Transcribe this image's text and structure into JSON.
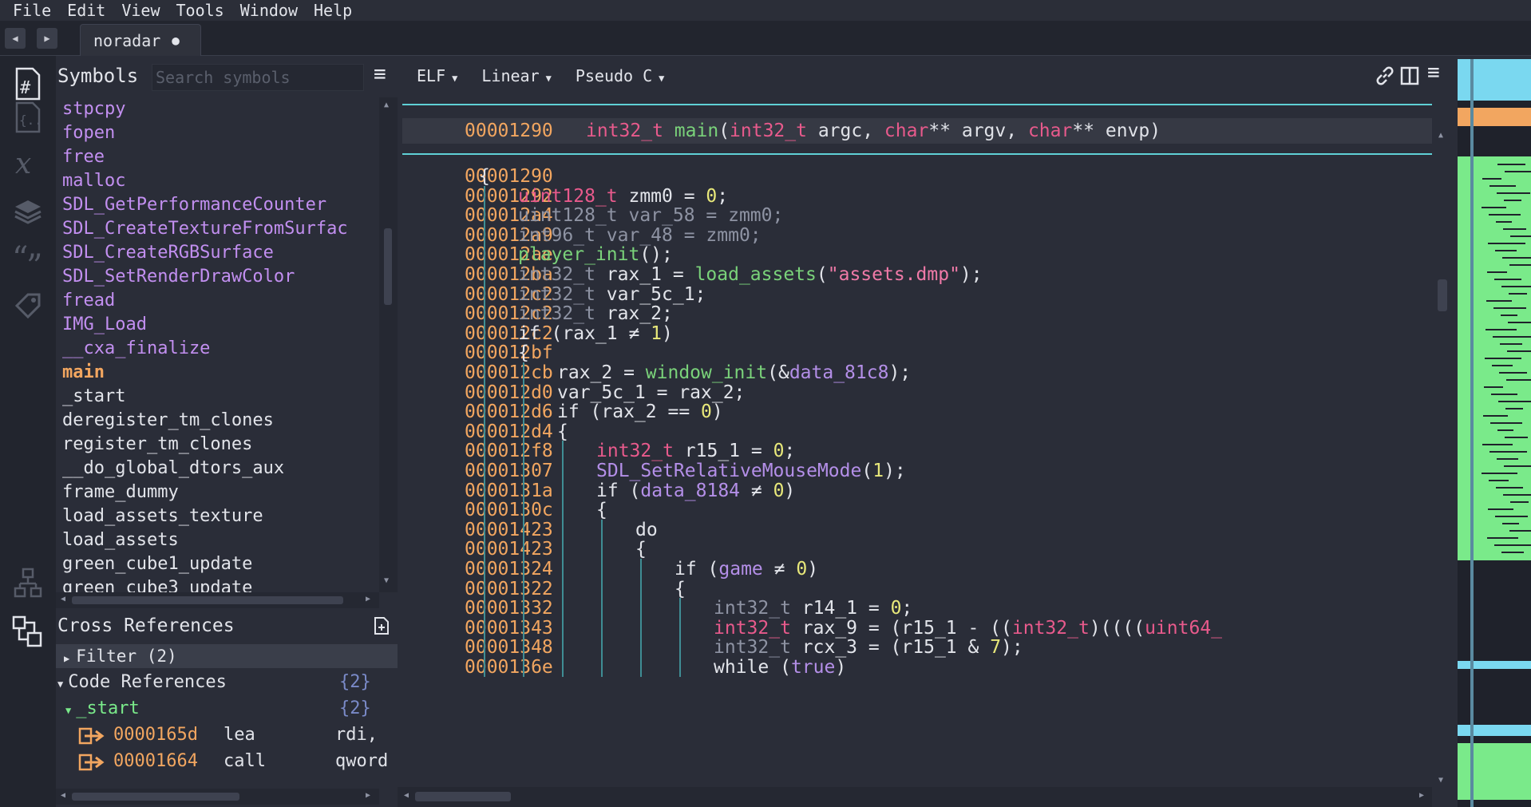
{
  "menu": [
    "File",
    "Edit",
    "View",
    "Tools",
    "Window",
    "Help"
  ],
  "tab": {
    "title": "noradar",
    "modified": "●",
    "back": "◀",
    "forward": "▶"
  },
  "symbols": {
    "title": "Symbols",
    "search_placeholder": "Search symbols",
    "items": [
      {
        "name": "stpcpy",
        "kind": "import"
      },
      {
        "name": "fopen",
        "kind": "import"
      },
      {
        "name": "free",
        "kind": "import"
      },
      {
        "name": "malloc",
        "kind": "import"
      },
      {
        "name": "SDL_GetPerformanceCounter",
        "kind": "import"
      },
      {
        "name": "SDL_CreateTextureFromSurfac",
        "kind": "import"
      },
      {
        "name": "SDL_CreateRGBSurface",
        "kind": "import"
      },
      {
        "name": "SDL_SetRenderDrawColor",
        "kind": "import"
      },
      {
        "name": "fread",
        "kind": "import"
      },
      {
        "name": "IMG_Load",
        "kind": "import"
      },
      {
        "name": "__cxa_finalize",
        "kind": "import"
      },
      {
        "name": "main",
        "kind": "selected"
      },
      {
        "name": "_start",
        "kind": "func"
      },
      {
        "name": "deregister_tm_clones",
        "kind": "func"
      },
      {
        "name": "register_tm_clones",
        "kind": "func"
      },
      {
        "name": "__do_global_dtors_aux",
        "kind": "func"
      },
      {
        "name": "frame_dummy",
        "kind": "func"
      },
      {
        "name": "load_assets_texture",
        "kind": "func"
      },
      {
        "name": "load_assets",
        "kind": "func"
      },
      {
        "name": "green_cube1_update",
        "kind": "func"
      },
      {
        "name": "green_cube3_update",
        "kind": "func"
      }
    ]
  },
  "xrefs": {
    "title": "Cross References",
    "filter": "Filter (2)",
    "code_refs_label": "Code References",
    "code_refs_count": "{2}",
    "func": "_start",
    "func_count": "{2}",
    "rows": [
      {
        "addr": "0000165d",
        "op": "lea",
        "arg": "rdi,"
      },
      {
        "addr": "00001664",
        "op": "call",
        "arg": "qword"
      }
    ]
  },
  "toolbar": {
    "view": "ELF",
    "layout": "Linear",
    "lang": "Pseudo C"
  },
  "code": {
    "header_addr": "00001290",
    "lines": [
      {
        "addr": "00001290",
        "indent": 0,
        "segs": [
          [
            "k",
            "{"
          ]
        ]
      },
      {
        "addr": "00001292",
        "indent": 1,
        "segs": [
          [
            "t",
            "uint128_t"
          ],
          [
            "k",
            " zmm0 = "
          ],
          [
            "n",
            "0"
          ],
          [
            "k",
            ";"
          ]
        ]
      },
      {
        "addr": "000012a4",
        "indent": 1,
        "segs": [
          [
            "dim",
            "uint128_t var_58 = zmm0;"
          ]
        ]
      },
      {
        "addr": "000012a9",
        "indent": 1,
        "segs": [
          [
            "dim",
            "int96_t var_48 = zmm0;"
          ]
        ]
      },
      {
        "addr": "000012ae",
        "indent": 1,
        "segs": [
          [
            "fn",
            "player_init"
          ],
          [
            "k",
            "();"
          ]
        ]
      },
      {
        "addr": "000012ba",
        "indent": 1,
        "segs": [
          [
            "dim",
            "int32_t"
          ],
          [
            "k",
            " rax_1 = "
          ],
          [
            "fn",
            "load_assets"
          ],
          [
            "k",
            "("
          ],
          [
            "s",
            "\"assets.dmp\""
          ],
          [
            "k",
            ");"
          ]
        ]
      },
      {
        "addr": "000012c2",
        "indent": 1,
        "segs": [
          [
            "dim",
            "int32_t"
          ],
          [
            "k",
            " var_5c_1;"
          ]
        ]
      },
      {
        "addr": "000012c2",
        "indent": 1,
        "segs": [
          [
            "dim",
            "int32_t"
          ],
          [
            "k",
            " rax_2;"
          ]
        ]
      },
      {
        "addr": "000012c2",
        "indent": 1,
        "segs": [
          [
            "k",
            "if (rax_1 ≠ "
          ],
          [
            "n",
            "1"
          ],
          [
            "k",
            ")"
          ]
        ]
      },
      {
        "addr": "000012bf",
        "indent": 1,
        "segs": [
          [
            "k",
            "{"
          ]
        ]
      },
      {
        "addr": "000012cb",
        "indent": 2,
        "segs": [
          [
            "k",
            "rax_2 = "
          ],
          [
            "fn",
            "window_init"
          ],
          [
            "k",
            "(&"
          ],
          [
            "v",
            "data_81c8"
          ],
          [
            "k",
            ");"
          ]
        ]
      },
      {
        "addr": "000012d0",
        "indent": 2,
        "segs": [
          [
            "k",
            "var_5c_1 = rax_2;"
          ]
        ]
      },
      {
        "addr": "000012d6",
        "indent": 2,
        "segs": [
          [
            "k",
            "if (rax_2 == "
          ],
          [
            "n",
            "0"
          ],
          [
            "k",
            ")"
          ]
        ]
      },
      {
        "addr": "000012d4",
        "indent": 2,
        "segs": [
          [
            "k",
            "{"
          ]
        ]
      },
      {
        "addr": "000012f8",
        "indent": 3,
        "segs": [
          [
            "t",
            "int32_t"
          ],
          [
            "k",
            " r15_1 = "
          ],
          [
            "n",
            "0"
          ],
          [
            "k",
            ";"
          ]
        ]
      },
      {
        "addr": "00001307",
        "indent": 3,
        "segs": [
          [
            "v",
            "SDL_SetRelativeMouseMode"
          ],
          [
            "k",
            "("
          ],
          [
            "n",
            "1"
          ],
          [
            "k",
            ");"
          ]
        ]
      },
      {
        "addr": "0000131a",
        "indent": 3,
        "segs": [
          [
            "k",
            "if ("
          ],
          [
            "v",
            "data_8184"
          ],
          [
            "k",
            " ≠ "
          ],
          [
            "n",
            "0"
          ],
          [
            "k",
            ")"
          ]
        ]
      },
      {
        "addr": "0000130c",
        "indent": 3,
        "segs": [
          [
            "k",
            "{"
          ]
        ]
      },
      {
        "addr": "00001423",
        "indent": 4,
        "segs": [
          [
            "k",
            "do"
          ]
        ]
      },
      {
        "addr": "00001423",
        "indent": 4,
        "segs": [
          [
            "k",
            "{"
          ]
        ]
      },
      {
        "addr": "00001324",
        "indent": 5,
        "segs": [
          [
            "k",
            "if ("
          ],
          [
            "v",
            "game"
          ],
          [
            "k",
            " ≠ "
          ],
          [
            "n",
            "0"
          ],
          [
            "k",
            ")"
          ]
        ]
      },
      {
        "addr": "00001322",
        "indent": 5,
        "segs": [
          [
            "k",
            "{"
          ]
        ]
      },
      {
        "addr": "00001332",
        "indent": 6,
        "segs": [
          [
            "dim",
            "int32_t"
          ],
          [
            "k",
            " r14_1 = "
          ],
          [
            "n",
            "0"
          ],
          [
            "k",
            ";"
          ]
        ]
      },
      {
        "addr": "00001343",
        "indent": 6,
        "segs": [
          [
            "t",
            "int32_t"
          ],
          [
            "k",
            " rax_9 = (r15_1 - (("
          ],
          [
            "t",
            "int32_t"
          ],
          [
            "k",
            ")(((("
          ],
          [
            "t",
            "uint64_"
          ]
        ]
      },
      {
        "addr": "00001348",
        "indent": 6,
        "segs": [
          [
            "dim",
            "int32_t"
          ],
          [
            "k",
            " rcx_3 = (r15_1 & "
          ],
          [
            "n",
            "7"
          ],
          [
            "k",
            ");"
          ]
        ]
      },
      {
        "addr": "0000136e",
        "indent": 6,
        "segs": [
          [
            "k",
            "while ("
          ],
          [
            "v",
            "true"
          ],
          [
            "k",
            ")"
          ]
        ]
      }
    ]
  },
  "minimap_bands": [
    {
      "color": "#7ad8f0",
      "from": 0.0,
      "to": 0.055
    },
    {
      "color": "#f2a660",
      "from": 0.065,
      "to": 0.09
    },
    {
      "color": "#7aea8a",
      "from": 0.13,
      "to": 0.67
    },
    {
      "color": "#7ad8f0",
      "from": 0.805,
      "to": 0.815
    },
    {
      "color": "#7ad8f0",
      "from": 0.89,
      "to": 0.905
    },
    {
      "color": "#7aea8a",
      "from": 0.915,
      "to": 0.99
    }
  ]
}
